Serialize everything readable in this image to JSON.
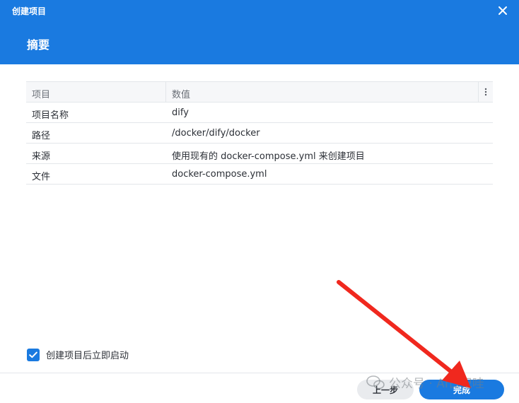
{
  "window": {
    "title": "创建项目",
    "close_icon": "close-icon"
  },
  "header": {
    "title": "摘要"
  },
  "grid": {
    "columns": [
      "项目",
      "数值"
    ],
    "column_menu_icon": "vertical-dots-icon",
    "rows": [
      {
        "key": "项目名称",
        "value": "dify"
      },
      {
        "key": "路径",
        "value": "/docker/dify/docker"
      },
      {
        "key": "来源",
        "value": "使用现有的 docker-compose.yml 来创建项目"
      },
      {
        "key": "文件",
        "value": "docker-compose.yml"
      }
    ]
  },
  "options": {
    "start_after_create": {
      "label": "创建项目后立即启动",
      "checked": true
    }
  },
  "footer": {
    "prev_label": "上一步",
    "done_label": "完成"
  },
  "watermark": {
    "text": "公众号 · AI日记哇"
  },
  "colors": {
    "accent": "#1a7ae0",
    "annotation_arrow": "#f0281e"
  }
}
